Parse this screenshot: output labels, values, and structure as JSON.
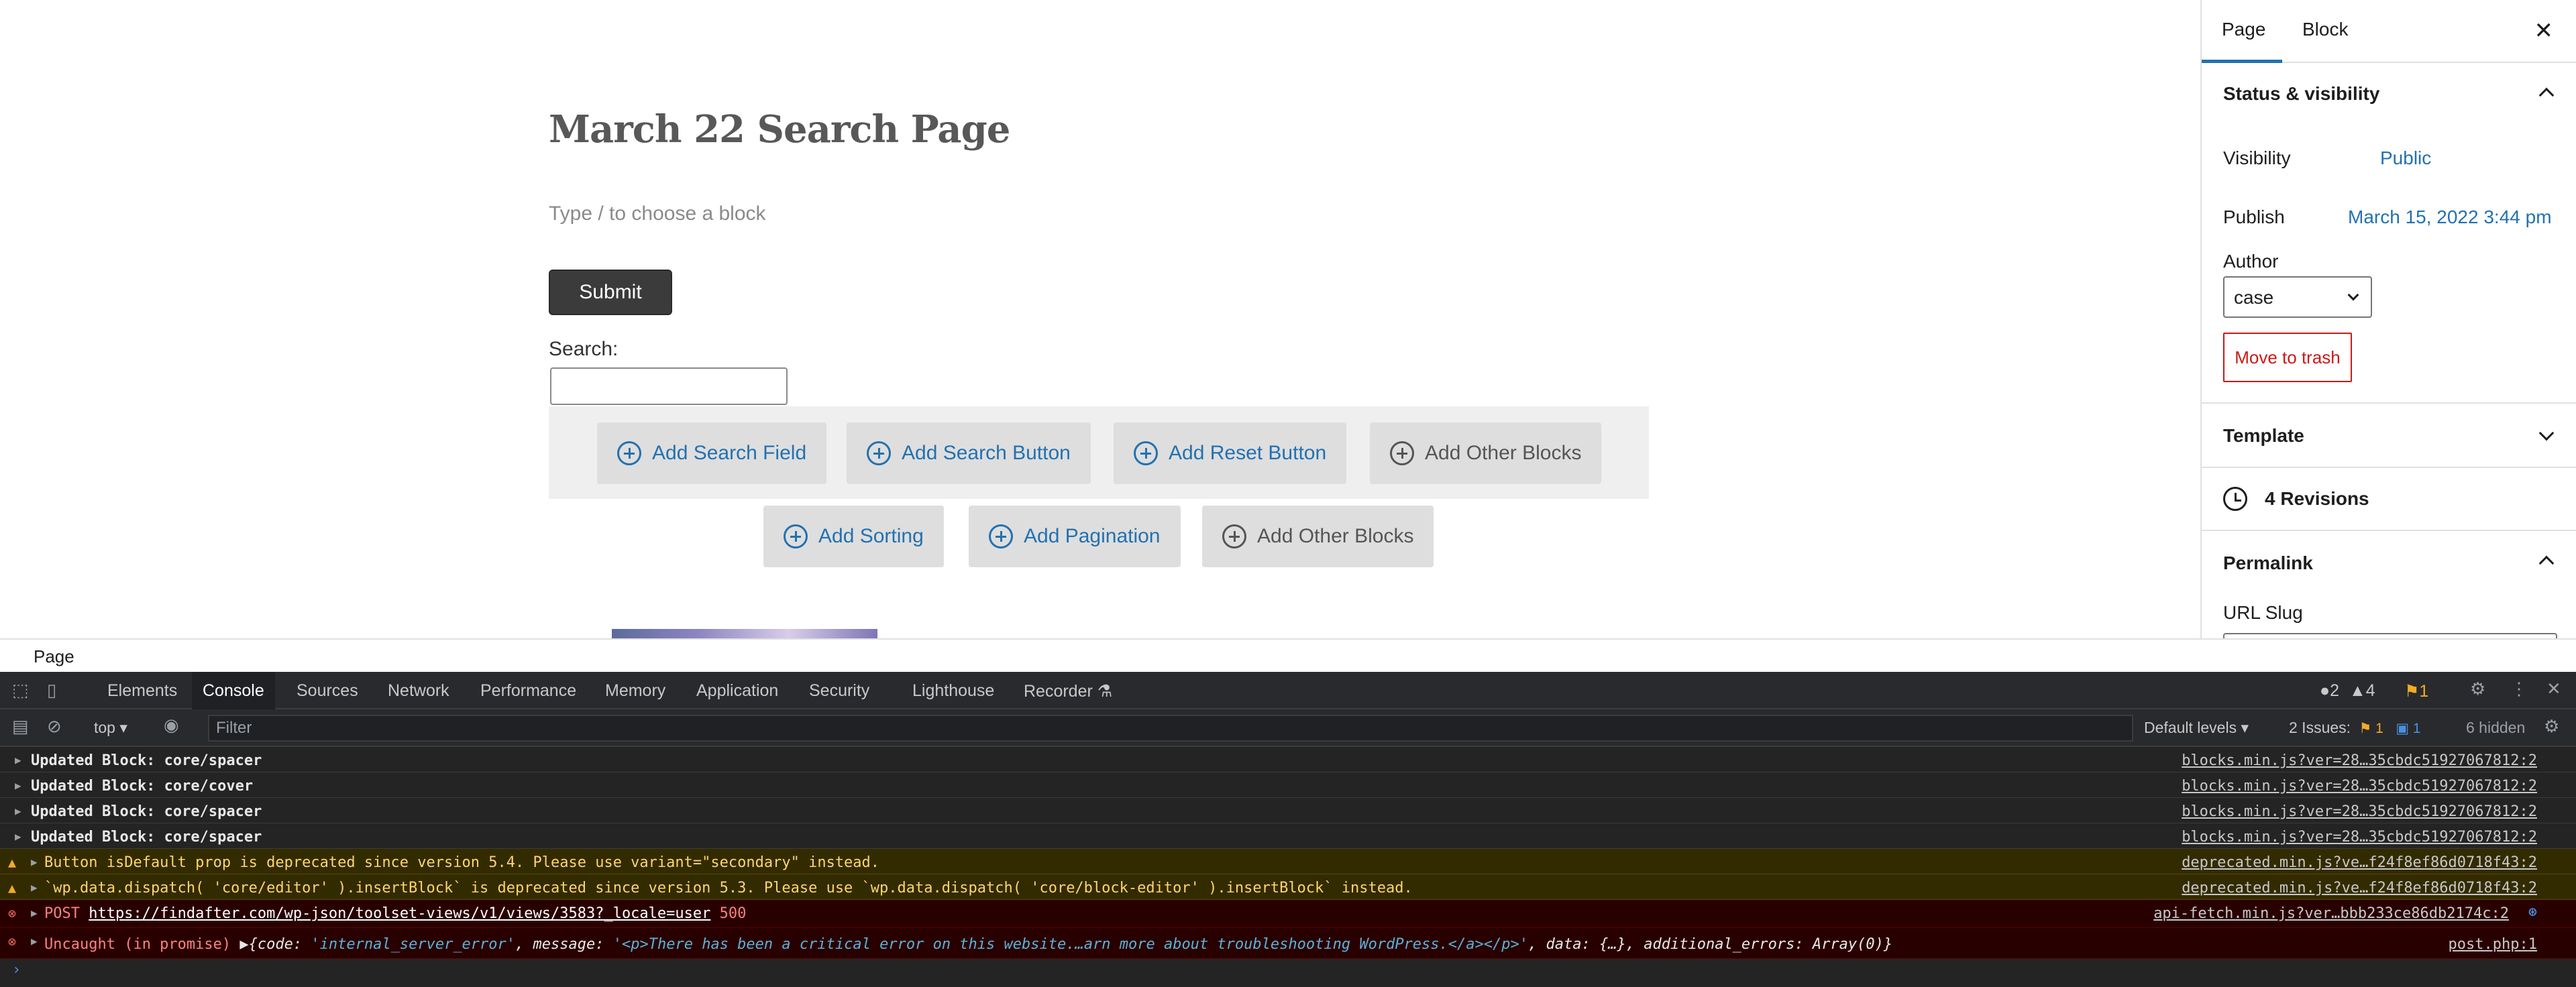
{
  "editor": {
    "title": "March 22 Search Page",
    "block_placeholder": "Type / to choose a block",
    "submit_label": "Submit",
    "search_label": "Search:",
    "search_value": "",
    "row1_buttons": [
      "Add Search Field",
      "Add Search Button",
      "Add Reset Button",
      "Add Other Blocks"
    ],
    "row2_buttons": [
      "Add Sorting",
      "Add Pagination",
      "Add Other Blocks"
    ]
  },
  "sidebar": {
    "tab_page": "Page",
    "tab_block": "Block",
    "close_icon": "close-icon",
    "status_heading": "Status & visibility",
    "visibility_label": "Visibility",
    "visibility_value": "Public",
    "publish_label": "Publish",
    "publish_value": "March 15, 2022 3:44 pm",
    "author_label": "Author",
    "author_value": "case",
    "trash_label": "Move to trash",
    "template_heading": "Template",
    "revisions_label": "4 Revisions",
    "permalink_heading": "Permalink",
    "url_slug_label": "URL Slug"
  },
  "footer": {
    "breadcrumb": "Page"
  },
  "devtools": {
    "tabs": [
      "Elements",
      "Console",
      "Sources",
      "Network",
      "Performance",
      "Memory",
      "Application",
      "Security",
      "Lighthouse",
      "Recorder ⚗"
    ],
    "active_tab": "Console",
    "counts": {
      "messages": "2",
      "warnings": "4",
      "issues": "1"
    },
    "context": "top",
    "filter_placeholder": "Filter",
    "levels": "Default levels",
    "issues_label": "2 Issues:",
    "issues_warn": "1",
    "issues_info": "1",
    "hidden": "6 hidden",
    "logs": [
      {
        "level": "info",
        "text": "Updated Block: core/spacer",
        "source": "blocks.min.js?ver=28…35cbdc51927067812:2"
      },
      {
        "level": "info",
        "text": "Updated Block: core/cover",
        "source": "blocks.min.js?ver=28…35cbdc51927067812:2"
      },
      {
        "level": "info",
        "text": "Updated Block: core/spacer",
        "source": "blocks.min.js?ver=28…35cbdc51927067812:2"
      },
      {
        "level": "info",
        "text": "Updated Block: core/spacer",
        "source": "blocks.min.js?ver=28…35cbdc51927067812:2"
      },
      {
        "level": "warn",
        "text": "Button isDefault prop is deprecated since version 5.4. Please use variant=\"secondary\" instead.",
        "source": "deprecated.min.js?ve…f24f8ef86d0718f43:2"
      },
      {
        "level": "warn",
        "text": "`wp.data.dispatch( 'core/editor' ).insertBlock` is deprecated since version 5.3. Please use `wp.data.dispatch( 'core/block-editor' ).insertBlock` instead.",
        "source": "deprecated.min.js?ve…f24f8ef86d0718f43:2"
      },
      {
        "level": "err",
        "method": "POST",
        "url": "https://findafter.com/wp-json/toolset-views/v1/views/3583?_locale=user",
        "status": "500",
        "source": "api-fetch.min.js?ver…bbb233ce86db2174c:2"
      },
      {
        "level": "err",
        "prefix": "Uncaught (in promise)",
        "code_key": "code",
        "code_val": "'internal_server_error'",
        "msg_key": "message",
        "msg_val": "'<p>There has been a critical error on this website.…arn more about troubleshooting WordPress.</a></p>'",
        "data_key": "data",
        "data_val": "{…}",
        "extra_key": "additional_errors",
        "extra_val": "Array(0)",
        "source": "post.php:1"
      }
    ],
    "prompt": "›"
  }
}
